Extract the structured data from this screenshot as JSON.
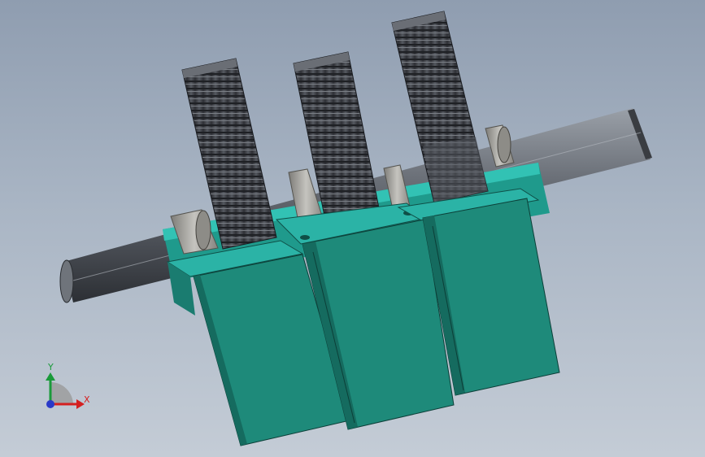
{
  "colors": {
    "background_top": "#8f9db0",
    "background_bottom": "#c4ccd6",
    "shaft": "#5a5f66",
    "gear": "#3f4247",
    "motor_body": "#1e8a7a",
    "motor_flange": "#2bb3a6",
    "bushing": "#a3a39e",
    "x_axis": "#d42020",
    "y_axis": "#1a9a3a",
    "z_axis": "#2a3ac8"
  },
  "triad": {
    "x_label": "X",
    "y_label": "Y"
  }
}
